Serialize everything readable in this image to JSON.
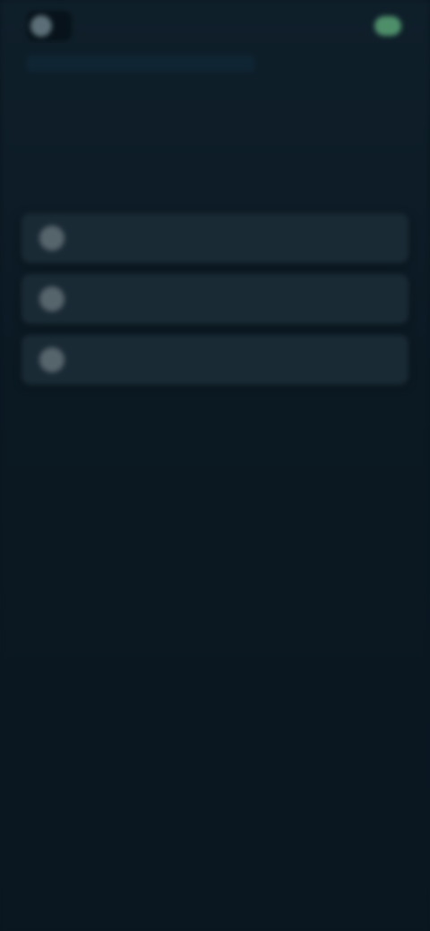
{
  "topbar": {
    "brand_name": "",
    "brand_icon": "logo-icon",
    "link_label": "",
    "action_icon": "toggle-icon",
    "accent_color": "#4e8f6a"
  },
  "notice": {
    "text": ""
  },
  "main": {
    "headline": ""
  },
  "options": [
    {
      "label": "",
      "icon": "circle-icon"
    },
    {
      "label": "",
      "icon": "circle-icon"
    },
    {
      "label": "",
      "icon": "circle-icon"
    }
  ]
}
